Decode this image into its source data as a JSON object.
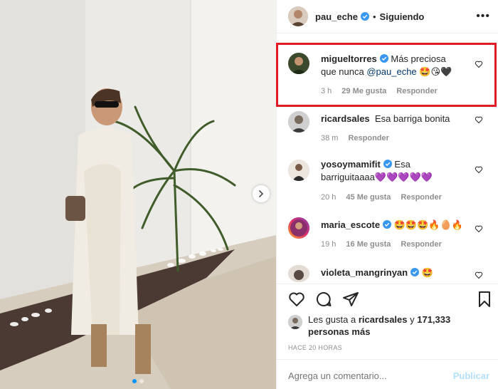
{
  "post": {
    "username": "pau_eche",
    "separator": "•",
    "follow_status": "Siguiendo",
    "more_icon": "•••"
  },
  "comments": [
    {
      "username": "migueltorres",
      "text_before": " Más preciosa que nunca ",
      "mention": "@pau_eche",
      "emojis": "🤩😘🖤",
      "time": "3 h",
      "likes": "29 Me gusta",
      "reply": "Responder",
      "avatar_color": "#3b4a2c"
    },
    {
      "username": "ricardsales",
      "text": "Esa barriga bonita",
      "time": "38 m",
      "reply": "Responder",
      "avatar_color": "#6b6b6b"
    },
    {
      "username": "yosoymamifit",
      "text": " Esa barriguitaaaa",
      "emojis": "💜💜💜💜💜",
      "time": "20 h",
      "likes": "45 Me gusta",
      "reply": "Responder",
      "avatar_color": "#d7d0c8"
    },
    {
      "username": "maria_escote",
      "emojis": "🤩🤩🤩🔥🥚🔥",
      "time": "19 h",
      "likes": "16 Me gusta",
      "reply": "Responder",
      "avatar_color": "#8a2f6a"
    },
    {
      "username": "violeta_mangrinyan",
      "emojis": "🤩",
      "avatar_color": "#5a4a44"
    }
  ],
  "likes": {
    "prefix": "Les gusta a ",
    "user": "ricardsales",
    "middle": " y ",
    "count": "171,333",
    "suffix": " personas más"
  },
  "time_ago": "HACE 20 HORAS",
  "add_comment": {
    "placeholder": "Agrega un comentario...",
    "publish": "Publicar"
  },
  "colors": {
    "highlight": "#e01b24",
    "verified": "#3897f0",
    "publish_disabled": "#b2dffc",
    "carousel_active_dot": "#0095f6"
  },
  "carousel": {
    "total": 2,
    "active": 1
  }
}
